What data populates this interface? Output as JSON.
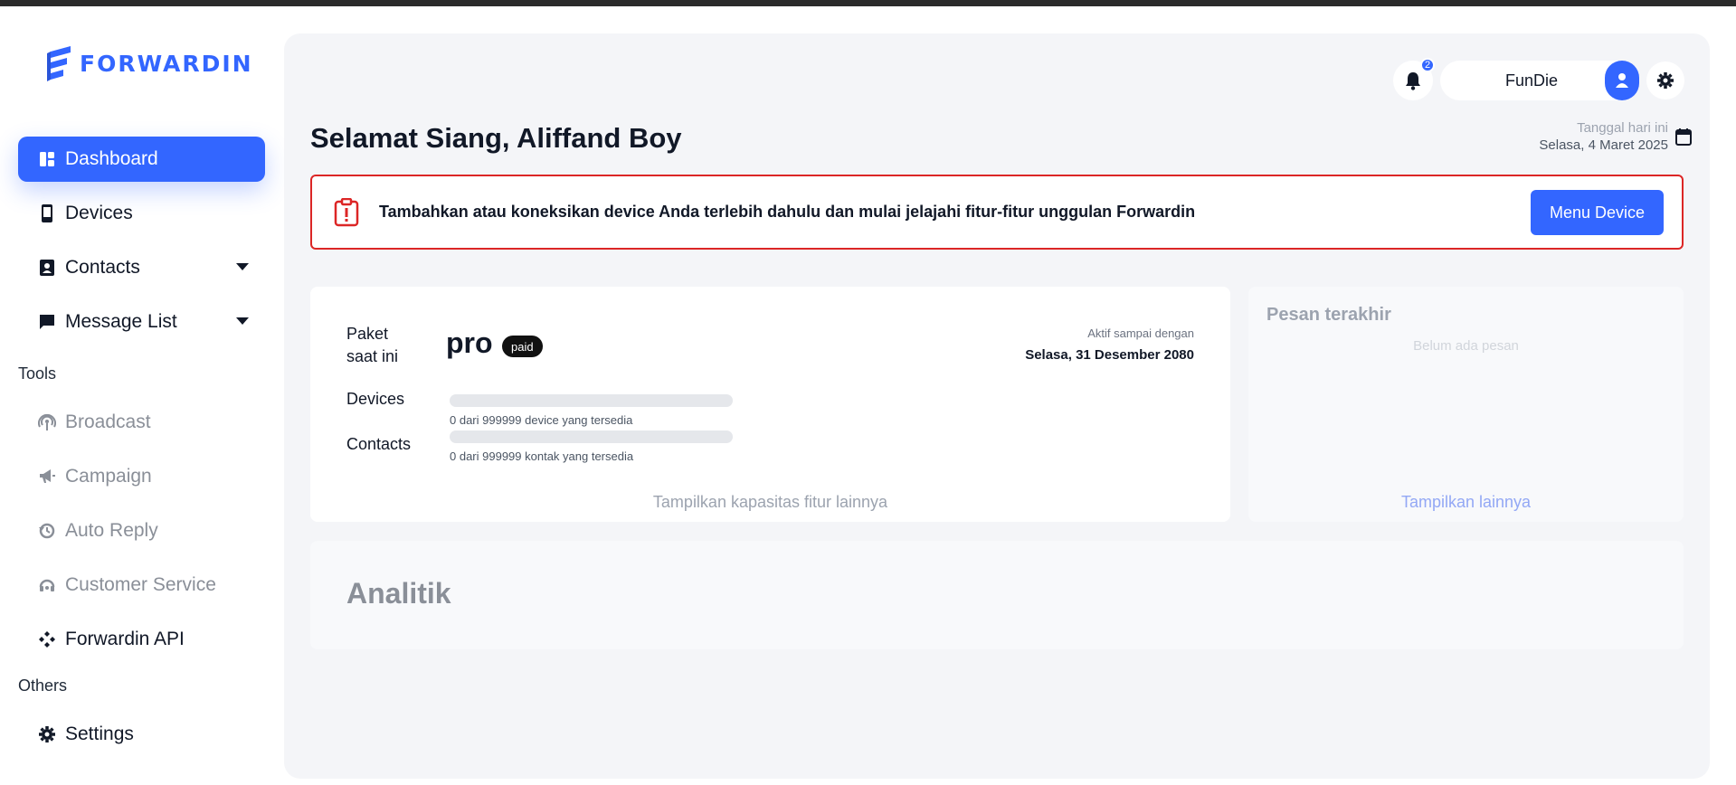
{
  "app": {
    "name": "FORWARDIN",
    "accent": "#3366ff"
  },
  "sidebar": {
    "items": [
      {
        "label": "Dashboard",
        "icon": "dashboard-icon",
        "active": true
      },
      {
        "label": "Devices",
        "icon": "phone-icon"
      },
      {
        "label": "Contacts",
        "icon": "contacts-icon",
        "expandable": true
      },
      {
        "label": "Message List",
        "icon": "chat-icon",
        "expandable": true
      }
    ],
    "tools_label": "Tools",
    "tools": [
      {
        "label": "Broadcast",
        "icon": "broadcast-icon",
        "disabled": true
      },
      {
        "label": "Campaign",
        "icon": "megaphone-icon",
        "disabled": true
      },
      {
        "label": "Auto Reply",
        "icon": "auto-reply-icon",
        "disabled": true
      },
      {
        "label": "Customer Service",
        "icon": "headset-icon",
        "disabled": true
      },
      {
        "label": "Forwardin API",
        "icon": "api-icon"
      }
    ],
    "others_label": "Others",
    "others": [
      {
        "label": "Settings",
        "icon": "gear-icon"
      }
    ]
  },
  "header": {
    "notification_count": "2",
    "username": "FunDie",
    "greeting": "Selamat Siang, Aliffand Boy",
    "date_label": "Tanggal hari ini",
    "date_value": "Selasa, 4 Maret 2025"
  },
  "alert": {
    "text": "Tambahkan atau koneksikan device Anda terlebih dahulu dan mulai jelajahi fitur-fitur unggulan Forwardin",
    "button": "Menu Device",
    "color": "#dc2626"
  },
  "plan": {
    "label": "Paket saat ini",
    "name": "pro",
    "badge": "paid",
    "active_label": "Aktif sampai dengan",
    "active_until": "Selasa, 31 Desember 2080",
    "devices_label": "Devices",
    "devices_text": "0 dari 999999 device yang tersedia",
    "devices_usage": 0,
    "contacts_label": "Contacts",
    "contacts_text": "0 dari 999999 kontak yang tersedia",
    "contacts_usage": 0,
    "more_link": "Tampilkan kapasitas fitur lainnya"
  },
  "messages": {
    "title": "Pesan terakhir",
    "empty": "Belum ada pesan",
    "more_link": "Tampilkan lainnya"
  },
  "analytics": {
    "title": "Analitik"
  }
}
